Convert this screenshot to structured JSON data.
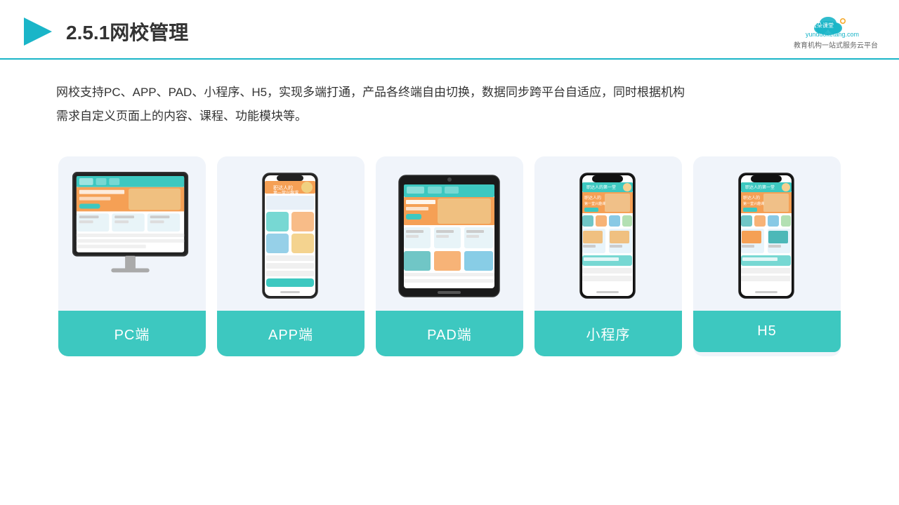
{
  "header": {
    "title": "2.5.1网校管理",
    "logo_name": "云朵课堂",
    "logo_sub": "yunduoketang.com",
    "logo_tagline": "教育机构一站\n式服务云平台"
  },
  "description": {
    "text": "网校支持PC、APP、PAD、小程序、H5，实现多端打通，产品各终端自由切换，数据同步跨平台自适应，同时根据机构需求自定义页面上的内容、课程、功能模块等。"
  },
  "cards": [
    {
      "id": "pc",
      "label": "PC端"
    },
    {
      "id": "app",
      "label": "APP端"
    },
    {
      "id": "pad",
      "label": "PAD端"
    },
    {
      "id": "miniapp",
      "label": "小程序"
    },
    {
      "id": "h5",
      "label": "H5"
    }
  ]
}
